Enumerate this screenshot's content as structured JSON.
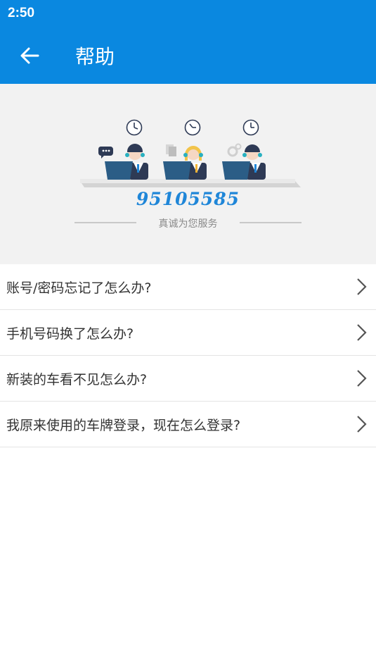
{
  "status_bar": {
    "time": "2:50"
  },
  "app_bar": {
    "title": "帮助",
    "back_icon": "arrow-left-icon"
  },
  "banner": {
    "hotline": "95105585",
    "slogan": "真诚为您服务",
    "illustration": "customer-service-agents"
  },
  "faq": [
    {
      "question": "账号/密码忘记了怎么办?"
    },
    {
      "question": "手机号码换了怎么办?"
    },
    {
      "question": "新装的车看不见怎么办?"
    },
    {
      "question": "我原来使用的车牌登录，现在怎么登录?"
    }
  ],
  "colors": {
    "primary": "#0a88e0",
    "hotline": "#1f86d8",
    "banner_bg": "#f2f2f2"
  }
}
